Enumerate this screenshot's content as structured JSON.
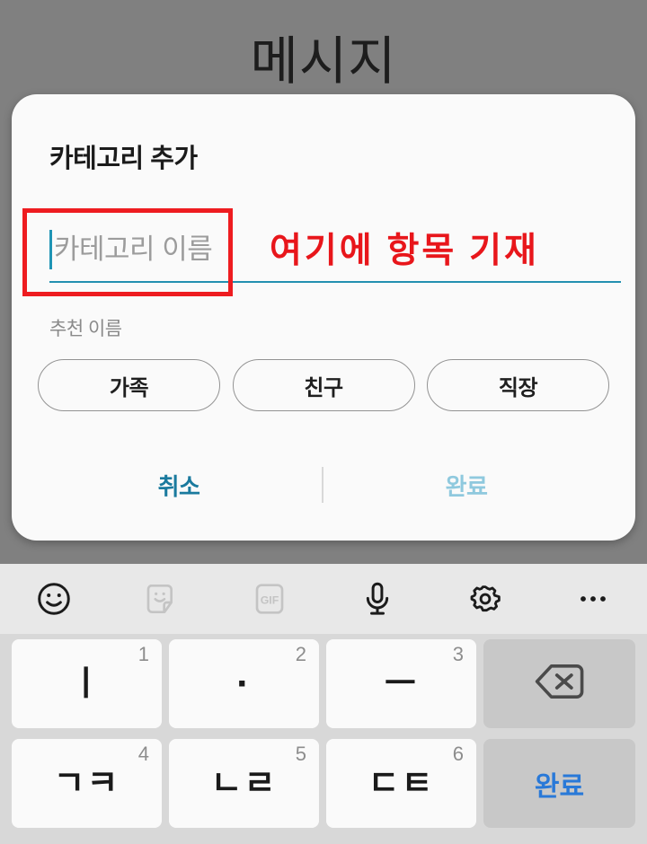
{
  "app": {
    "title": "메시지"
  },
  "dialog": {
    "title": "카테고리 추가",
    "input": {
      "name": "category-name-input",
      "value": "",
      "placeholder": "카테고리 이름"
    },
    "suggestion_label": "추천 이름",
    "suggestions": [
      {
        "label": "가족"
      },
      {
        "label": "친구"
      },
      {
        "label": "직장"
      }
    ],
    "actions": {
      "cancel_label": "취소",
      "done_label": "완료"
    }
  },
  "annotation": {
    "text": "여기에 항목 기재",
    "color": "#e8161b",
    "box_color": "#ee1c20"
  },
  "keyboard": {
    "toolbar": [
      {
        "icon": "emoji-icon",
        "state": "enabled"
      },
      {
        "icon": "sticker-icon",
        "state": "disabled"
      },
      {
        "icon": "gif-icon",
        "label": "GIF",
        "state": "disabled"
      },
      {
        "icon": "microphone-icon",
        "state": "enabled"
      },
      {
        "icon": "settings-gear-icon",
        "state": "enabled"
      },
      {
        "icon": "more-options-icon",
        "state": "enabled"
      }
    ],
    "rows": [
      [
        {
          "glyph": "ㅣ",
          "num": "1",
          "type": "char"
        },
        {
          "glyph": "·",
          "num": "2",
          "type": "char"
        },
        {
          "glyph": "ㅡ",
          "num": "3",
          "type": "char"
        },
        {
          "glyph": "",
          "num": "",
          "type": "backspace"
        }
      ],
      [
        {
          "glyph": "ㄱㅋ",
          "num": "4",
          "type": "char"
        },
        {
          "glyph": "ㄴㄹ",
          "num": "5",
          "type": "char"
        },
        {
          "glyph": "ㄷㅌ",
          "num": "6",
          "type": "char"
        },
        {
          "glyph": "완료",
          "num": "",
          "type": "enter"
        }
      ]
    ]
  },
  "colors": {
    "accent_teal": "#1a7a9e",
    "accent_teal_disabled": "#8fc9de",
    "underline": "#2390b0",
    "caret": "#1f94b5",
    "enter_blue": "#2979d8",
    "scrim": "#808080"
  }
}
